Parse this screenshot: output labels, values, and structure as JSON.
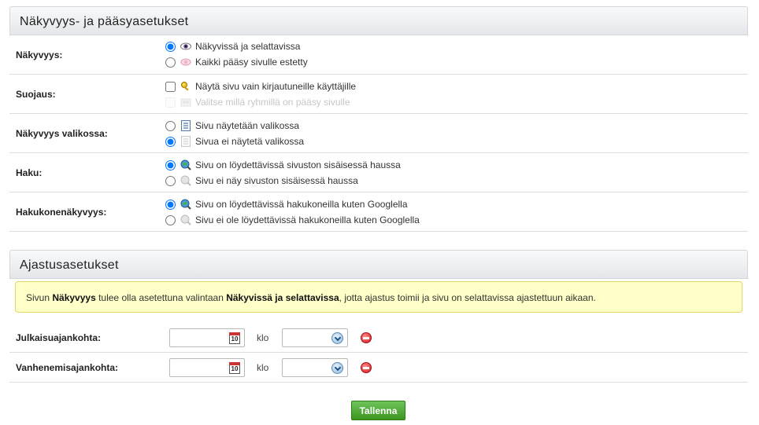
{
  "visibility_panel": {
    "title": "Näkyvyys- ja pääsyasetukset",
    "rows": [
      {
        "label": "Näkyvyys:",
        "options": [
          {
            "type": "radio",
            "checked": true,
            "icon": "eye-icon",
            "text": "Näkyvissä ja selattavissa"
          },
          {
            "type": "radio",
            "checked": false,
            "icon": "hidden-eye-icon",
            "text": "Kaikki pääsy sivulle estetty"
          }
        ]
      },
      {
        "label": "Suojaus:",
        "options": [
          {
            "type": "checkbox",
            "checked": false,
            "icon": "key-icon",
            "text": "Näytä sivu vain kirjautuneille käyttäjille"
          },
          {
            "type": "checkbox",
            "checked": false,
            "disabled": true,
            "icon": "group-icon",
            "text": "Valitse millä ryhmillä on pääsy sivulle"
          }
        ]
      },
      {
        "label": "Näkyvyys valikossa:",
        "options": [
          {
            "type": "radio",
            "checked": false,
            "icon": "menu-list-icon",
            "text": "Sivu näytetään valikossa"
          },
          {
            "type": "radio",
            "checked": true,
            "icon": "menu-hidden-icon",
            "text": "Sivua ei näytetä valikossa"
          }
        ]
      },
      {
        "label": "Haku:",
        "options": [
          {
            "type": "radio",
            "checked": true,
            "icon": "search-globe-icon",
            "text": "Sivu on löydettävissä sivuston sisäisessä haussa"
          },
          {
            "type": "radio",
            "checked": false,
            "icon": "search-globe-disabled-icon",
            "text": "Sivu ei näy sivuston sisäisessä haussa"
          }
        ]
      },
      {
        "label": "Hakukonenäkyvyys:",
        "options": [
          {
            "type": "radio",
            "checked": true,
            "icon": "search-globe-icon",
            "text": "Sivu on löydettävissä hakukoneilla kuten Googlella"
          },
          {
            "type": "radio",
            "checked": false,
            "icon": "search-globe-disabled-icon",
            "text": "Sivu ei ole löydettävissä hakukoneilla kuten Googlella"
          }
        ]
      }
    ]
  },
  "schedule_panel": {
    "title": "Ajastusasetukset",
    "notice": {
      "part1": "Sivun ",
      "bold1": "Näkyvyys",
      "part2": " tulee olla asetettuna valintaan ",
      "bold2": "Näkyvissä ja selattavissa",
      "part3": ", jotta ajastus toimii ja sivu on selattavissa ajastettuun aikaan."
    },
    "rows": [
      {
        "label": "Julkaisuajankohta:",
        "date_value": "",
        "calendar_day": "10",
        "klo": "klo",
        "time_value": ""
      },
      {
        "label": "Vanhenemisajankohta:",
        "date_value": "",
        "calendar_day": "10",
        "klo": "klo",
        "time_value": ""
      }
    ]
  },
  "save_button": "Tallenna",
  "colors": {
    "accent_green": "#3b951f",
    "notice_bg": "#ffffc8",
    "remove_red": "#d3161a"
  }
}
